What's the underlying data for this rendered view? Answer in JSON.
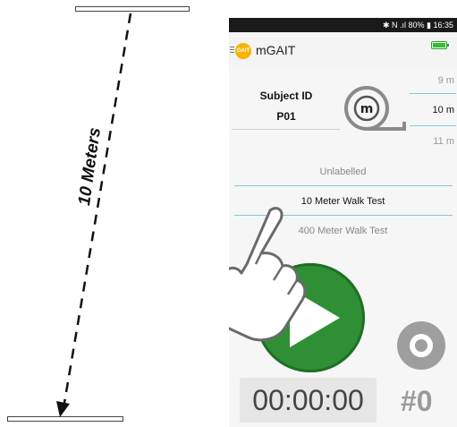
{
  "illustration": {
    "distance_label": "10 Meters"
  },
  "status_bar": {
    "text": "✱ N .ıl 80% ▮ 16:35"
  },
  "app_bar": {
    "title": "mGAIT",
    "logo_text": "GAIT"
  },
  "subject": {
    "label": "Subject ID",
    "value": "P01"
  },
  "distance_picker": {
    "options": [
      "9 m",
      "10 m",
      "11 m"
    ],
    "selected": "10 m"
  },
  "tests": {
    "options": [
      "Unlabelled",
      "10 Meter Walk Test",
      "400 Meter Walk Test"
    ],
    "selected": "10 Meter Walk Test"
  },
  "controls": {
    "timer": "00:00:00",
    "counter": "#0"
  },
  "colors": {
    "accent_green": "#2f8f35",
    "logo_yellow": "#f4b400",
    "divider_blue": "#80c7e0"
  },
  "icons": [
    "menu-icon",
    "app-logo-icon",
    "battery-icon",
    "tape-measure-icon",
    "hand-pointer-icon",
    "play-icon",
    "stop-icon"
  ]
}
